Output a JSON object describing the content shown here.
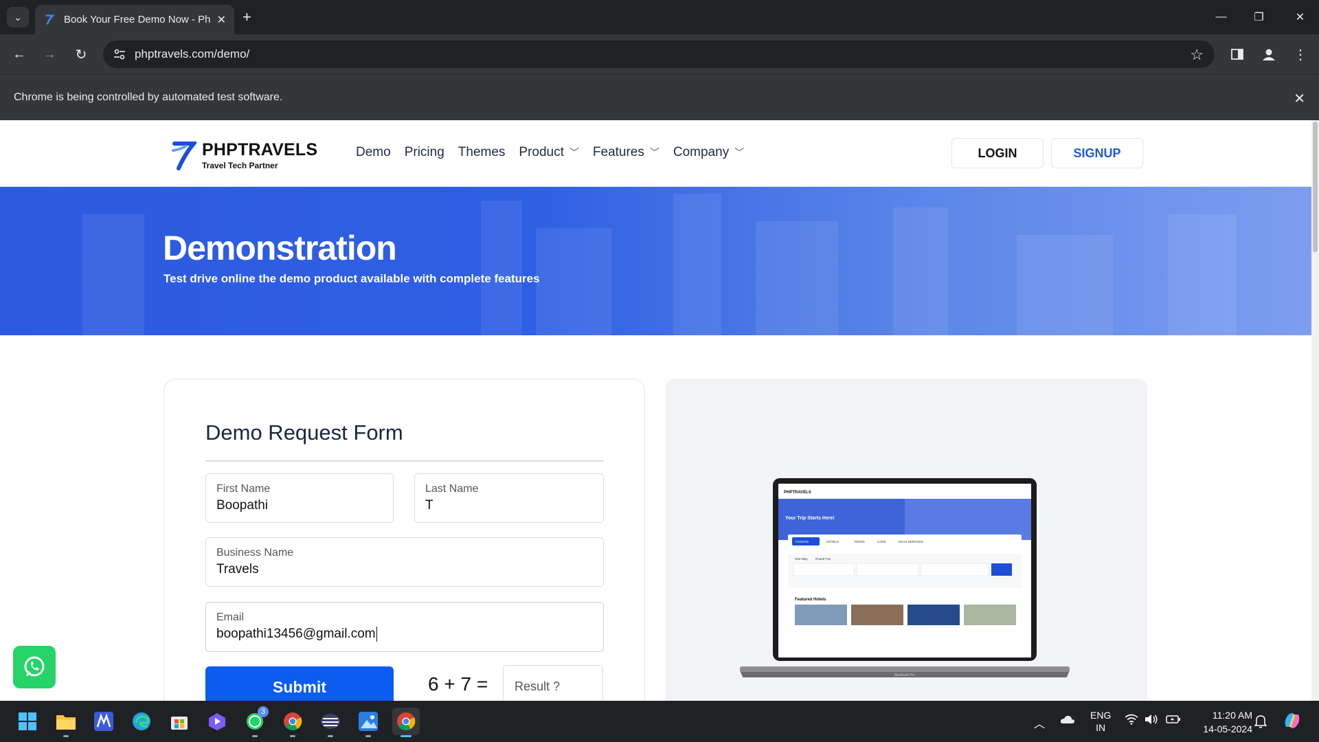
{
  "browser": {
    "tab_title": "Book Your Free Demo Now - Ph",
    "url": "phptravels.com/demo/",
    "infobar_text": "Chrome is being controlled by automated test software."
  },
  "site": {
    "brand_name": "PHPTRAVELS",
    "brand_tagline": "Travel Tech Partner",
    "nav": [
      {
        "label": "Demo"
      },
      {
        "label": "Pricing"
      },
      {
        "label": "Themes"
      },
      {
        "label": "Product"
      },
      {
        "label": "Features"
      },
      {
        "label": "Company"
      }
    ],
    "login_label": "LOGIN",
    "signup_label": "SIGNUP"
  },
  "hero": {
    "title": "Demonstration",
    "subtitle": "Test drive online the demo product available with complete features"
  },
  "form": {
    "title": "Demo Request Form",
    "first_name": {
      "label": "First Name",
      "value": "Boopathi"
    },
    "last_name": {
      "label": "Last Name",
      "value": "T"
    },
    "business_name": {
      "label": "Business Name",
      "value": "Travels"
    },
    "email": {
      "label": "Email",
      "value": "boopathi13456@gmail.com"
    },
    "submit_label": "Submit",
    "captcha": "6 + 7 =",
    "result_placeholder": "Result ?"
  },
  "preview": {
    "hero_title": "Your Trip Starts Here!",
    "featured": "Featured Hotels",
    "tabs": [
      "FLIGHTS",
      "HOTELS",
      "TOURS",
      "CARS",
      "VISAS SERVICES"
    ],
    "trip_types": [
      "One Way",
      "Round Trip"
    ],
    "laptop_label": "MacBook Pro"
  },
  "taskbar": {
    "lang_line1": "ENG",
    "lang_line2": "IN",
    "time": "11:20 AM",
    "date": "14-05-2024",
    "whatsapp_badge": "3"
  },
  "colors": {
    "brand_blue": "#0d5cf2",
    "hero_blue": "#2e5fe3",
    "whatsapp_green": "#25d366"
  }
}
